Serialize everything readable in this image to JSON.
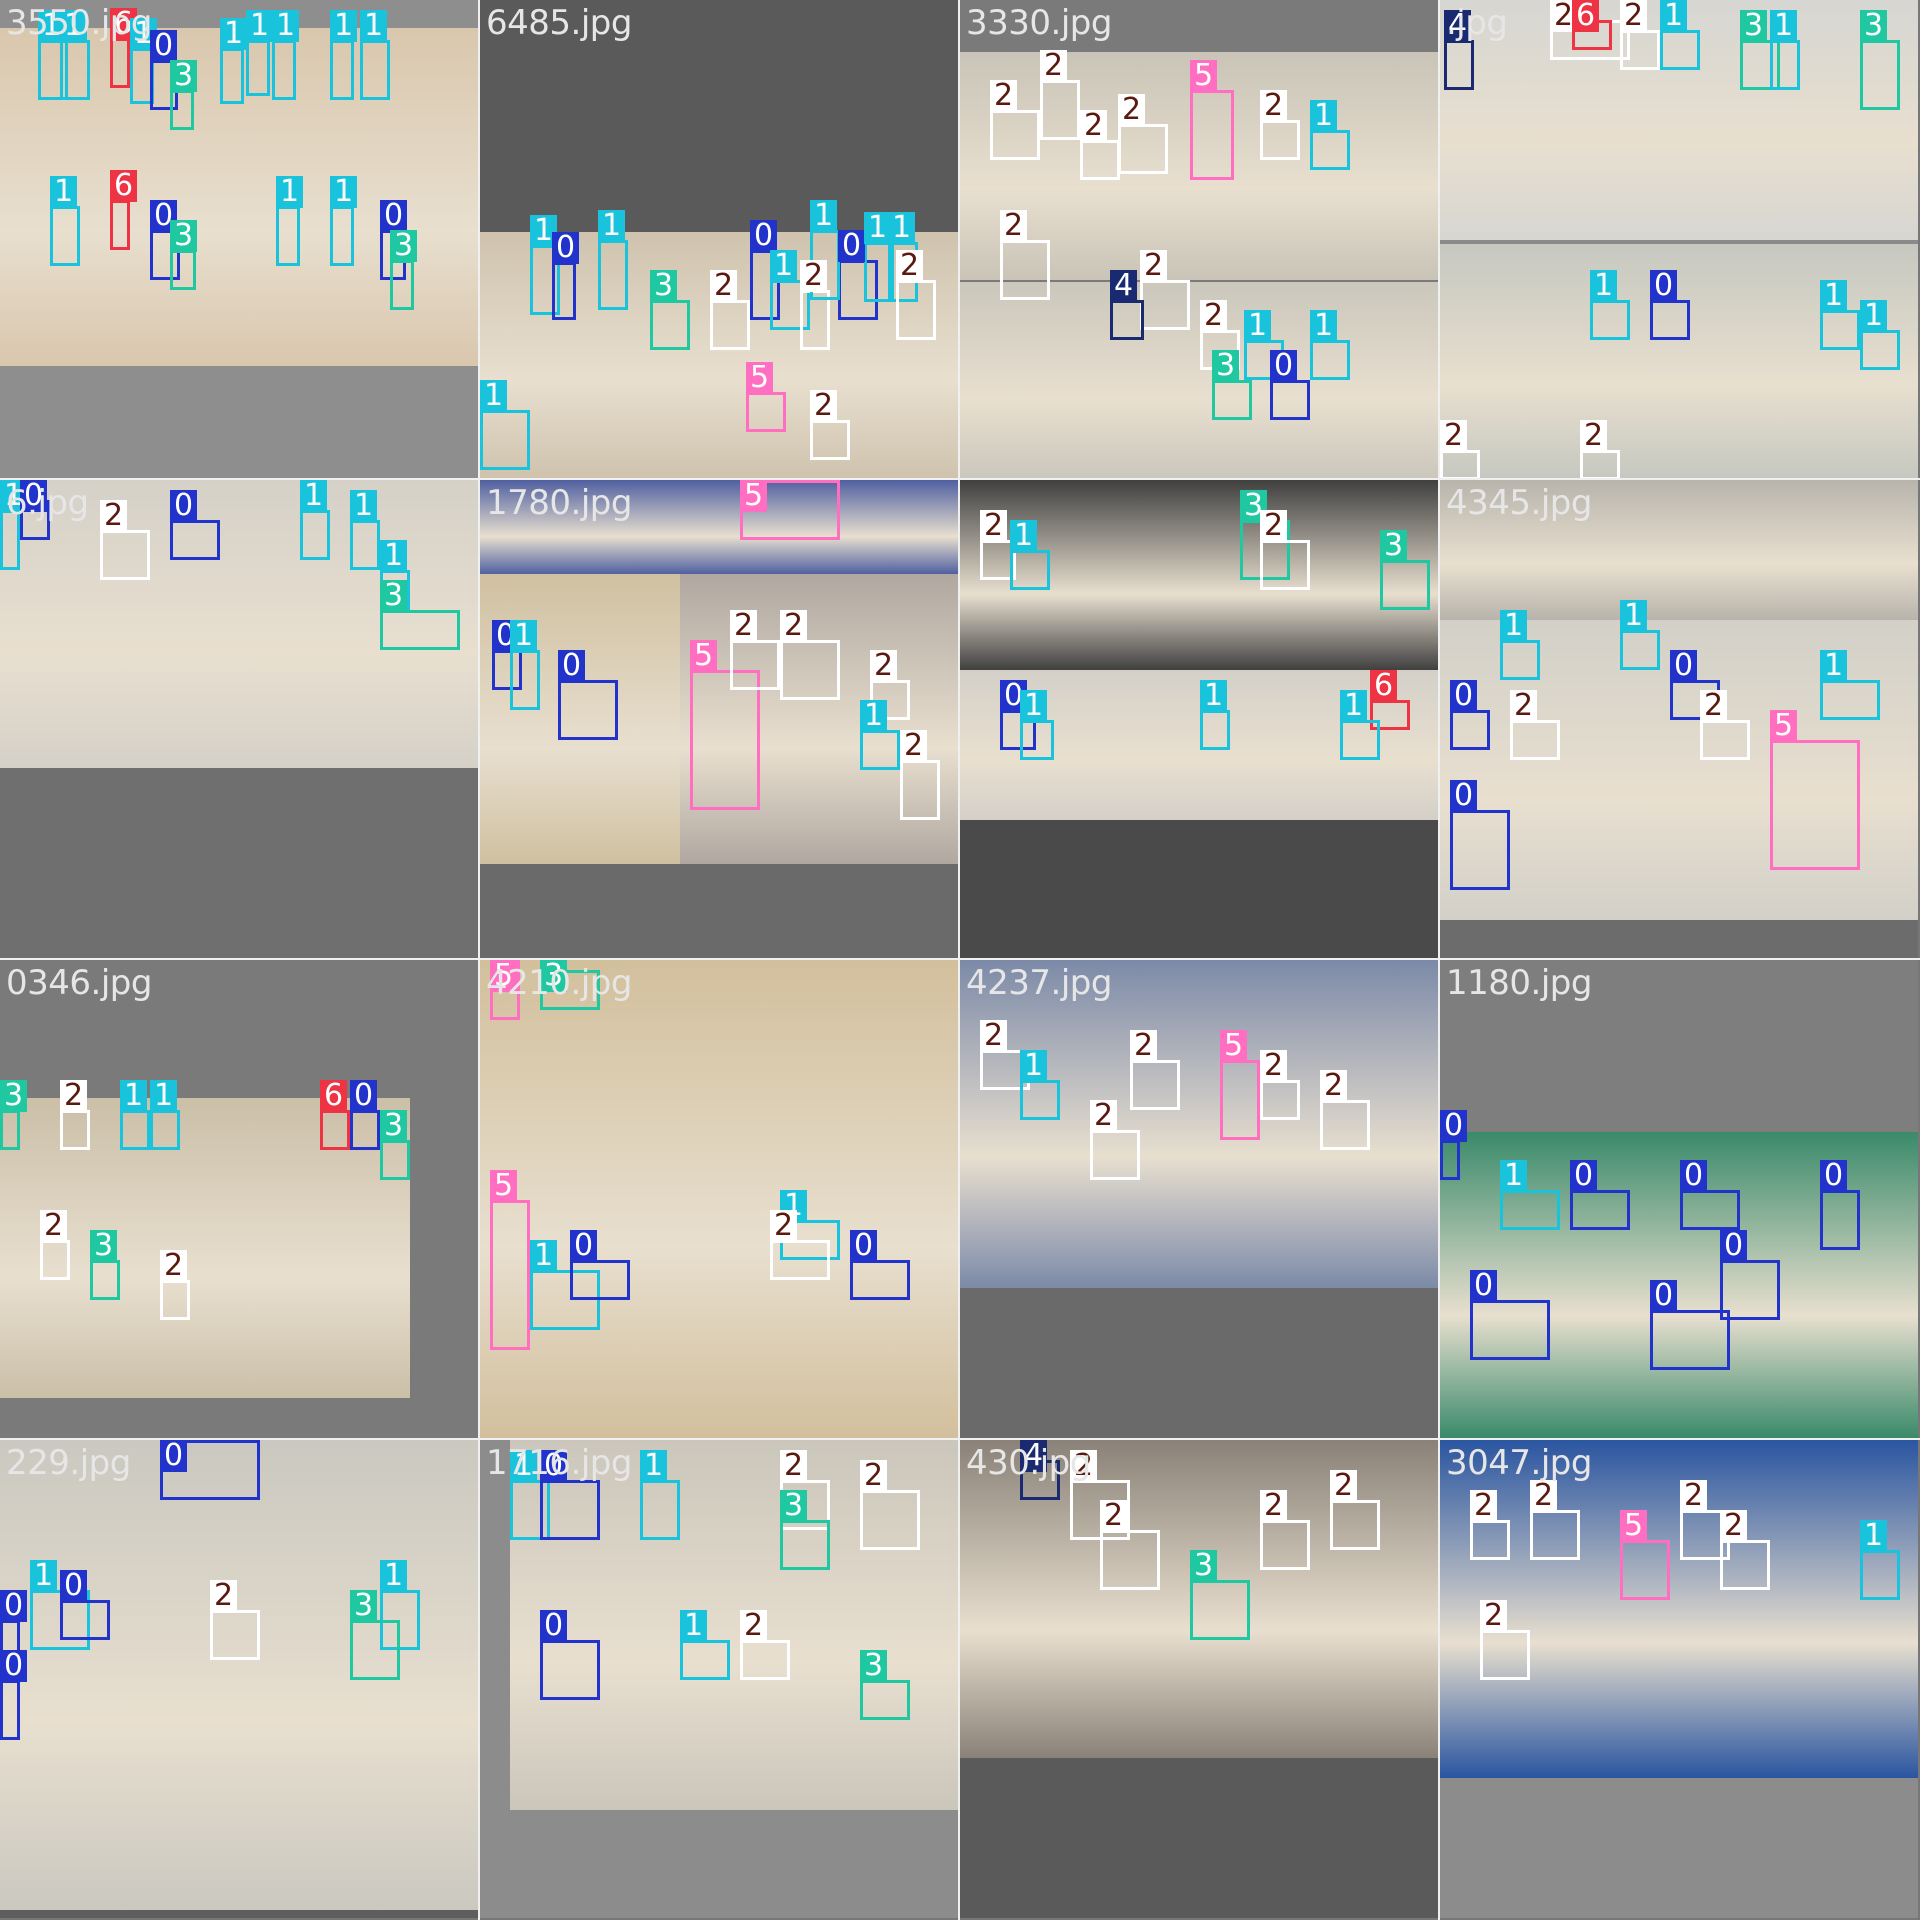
{
  "palette": {
    "0": {
      "border": "#2233cc",
      "bg": "#2233cc",
      "fg": "#ffffff"
    },
    "1": {
      "border": "#19c3dc",
      "bg": "#19c3dc",
      "fg": "#ffffff"
    },
    "2": {
      "border": "#ffffff",
      "bg": "#ffffff",
      "fg": "#5a1a10"
    },
    "3": {
      "border": "#1fc8a0",
      "bg": "#1fc8a0",
      "fg": "#ffffff"
    },
    "4": {
      "border": "#1a2a70",
      "bg": "#1a2a70",
      "fg": "#ffffff"
    },
    "5": {
      "border": "#ff6ec0",
      "bg": "#ff6ec0",
      "fg": "#ffffff"
    },
    "6": {
      "border": "#ee3344",
      "bg": "#ee3344",
      "fg": "#ffffff"
    }
  },
  "tiles": [
    {
      "name": "3550.jpg",
      "bg": "#8e8e8e"
    },
    {
      "name": "6485.jpg",
      "bg": "#5a5a5a"
    },
    {
      "name": "3330.jpg",
      "bg": "#7a7a7a"
    },
    {
      "name": ".jpg",
      "bg": "#8a8a8a"
    },
    {
      "name": "6.jpg",
      "bg": "#6f6f6f"
    },
    {
      "name": "1780.jpg",
      "bg": "#6a6a6a"
    },
    {
      "name": "",
      "bg": "#4a4a4a"
    },
    {
      "name": "4345.jpg",
      "bg": "#6c6c6c"
    },
    {
      "name": "0346.jpg",
      "bg": "#7a7a7a"
    },
    {
      "name": "4210.jpg",
      "bg": "#8a7a6a"
    },
    {
      "name": "4237.jpg",
      "bg": "#6a6a6a"
    },
    {
      "name": "1180.jpg",
      "bg": "#7e7e7e"
    },
    {
      "name": "229.jpg",
      "bg": "#5e5e5e"
    },
    {
      "name": "1716.jpg",
      "bg": "#8c8c8c"
    },
    {
      "name": "430.jpg",
      "bg": "#5a5a5a"
    },
    {
      "name": "3047.jpg",
      "bg": "#8c8c8c"
    }
  ],
  "detections": [
    {
      "tile": 0,
      "cls": "1"
    },
    {
      "tile": 0,
      "cls": "1"
    },
    {
      "tile": 0,
      "cls": "6"
    },
    {
      "tile": 0,
      "cls": "1"
    },
    {
      "tile": 0,
      "cls": "0"
    },
    {
      "tile": 0,
      "cls": "3"
    },
    {
      "tile": 0,
      "cls": "1"
    },
    {
      "tile": 0,
      "cls": "1"
    },
    {
      "tile": 0,
      "cls": "1"
    },
    {
      "tile": 0,
      "cls": "1"
    },
    {
      "tile": 0,
      "cls": "1"
    },
    {
      "tile": 0,
      "cls": "0"
    },
    {
      "tile": 0,
      "cls": "3"
    },
    {
      "tile": 0,
      "cls": "1"
    },
    {
      "tile": 0,
      "cls": "6"
    },
    {
      "tile": 0,
      "cls": "0"
    },
    {
      "tile": 0,
      "cls": "3"
    },
    {
      "tile": 0,
      "cls": "1"
    },
    {
      "tile": 0,
      "cls": "1"
    },
    {
      "tile": 1,
      "cls": "1"
    },
    {
      "tile": 1,
      "cls": "0"
    },
    {
      "tile": 1,
      "cls": "1"
    },
    {
      "tile": 1,
      "cls": "3"
    },
    {
      "tile": 1,
      "cls": "2"
    },
    {
      "tile": 1,
      "cls": "0"
    },
    {
      "tile": 1,
      "cls": "1"
    },
    {
      "tile": 1,
      "cls": "2"
    },
    {
      "tile": 1,
      "cls": "0"
    },
    {
      "tile": 1,
      "cls": "1"
    },
    {
      "tile": 1,
      "cls": "1"
    },
    {
      "tile": 1,
      "cls": "2"
    },
    {
      "tile": 1,
      "cls": "1"
    },
    {
      "tile": 1,
      "cls": "5"
    },
    {
      "tile": 1,
      "cls": "1"
    },
    {
      "tile": 1,
      "cls": "2"
    },
    {
      "tile": 2,
      "cls": "2"
    },
    {
      "tile": 2,
      "cls": "2"
    },
    {
      "tile": 2,
      "cls": "5"
    },
    {
      "tile": 2,
      "cls": "2"
    },
    {
      "tile": 2,
      "cls": "2"
    },
    {
      "tile": 2,
      "cls": "1"
    },
    {
      "tile": 2,
      "cls": "2"
    },
    {
      "tile": 2,
      "cls": "2"
    },
    {
      "tile": 2,
      "cls": "4"
    },
    {
      "tile": 2,
      "cls": "2"
    },
    {
      "tile": 2,
      "cls": "3"
    },
    {
      "tile": 2,
      "cls": "1"
    },
    {
      "tile": 2,
      "cls": "0"
    },
    {
      "tile": 2,
      "cls": "1"
    },
    {
      "tile": 2,
      "cls": "2"
    },
    {
      "tile": 3,
      "cls": "4"
    },
    {
      "tile": 3,
      "cls": "2"
    },
    {
      "tile": 3,
      "cls": "6"
    },
    {
      "tile": 3,
      "cls": "2"
    },
    {
      "tile": 3,
      "cls": "1"
    },
    {
      "tile": 3,
      "cls": "3"
    },
    {
      "tile": 3,
      "cls": "3"
    },
    {
      "tile": 3,
      "cls": "1"
    },
    {
      "tile": 3,
      "cls": "1"
    },
    {
      "tile": 3,
      "cls": "0"
    },
    {
      "tile": 3,
      "cls": "1"
    },
    {
      "tile": 3,
      "cls": "1"
    },
    {
      "tile": 3,
      "cls": "2"
    },
    {
      "tile": 3,
      "cls": "2"
    },
    {
      "tile": 4,
      "cls": "1"
    },
    {
      "tile": 4,
      "cls": "0"
    },
    {
      "tile": 4,
      "cls": "2"
    },
    {
      "tile": 4,
      "cls": "0"
    },
    {
      "tile": 4,
      "cls": "1"
    },
    {
      "tile": 4,
      "cls": "1"
    },
    {
      "tile": 4,
      "cls": "1"
    },
    {
      "tile": 4,
      "cls": "3"
    },
    {
      "tile": 5,
      "cls": "5"
    },
    {
      "tile": 5,
      "cls": "0"
    },
    {
      "tile": 5,
      "cls": "1"
    },
    {
      "tile": 5,
      "cls": "0"
    },
    {
      "tile": 5,
      "cls": "5"
    },
    {
      "tile": 5,
      "cls": "2"
    },
    {
      "tile": 5,
      "cls": "2"
    },
    {
      "tile": 5,
      "cls": "2"
    },
    {
      "tile": 5,
      "cls": "1"
    },
    {
      "tile": 5,
      "cls": "2"
    },
    {
      "tile": 6,
      "cls": "2"
    },
    {
      "tile": 6,
      "cls": "1"
    },
    {
      "tile": 6,
      "cls": "3"
    },
    {
      "tile": 6,
      "cls": "2"
    },
    {
      "tile": 6,
      "cls": "3"
    },
    {
      "tile": 6,
      "cls": "0"
    },
    {
      "tile": 6,
      "cls": "1"
    },
    {
      "tile": 6,
      "cls": "1"
    },
    {
      "tile": 6,
      "cls": "6"
    },
    {
      "tile": 6,
      "cls": "1"
    },
    {
      "tile": 7,
      "cls": "1"
    },
    {
      "tile": 7,
      "cls": "0"
    },
    {
      "tile": 7,
      "cls": "2"
    },
    {
      "tile": 7,
      "cls": "1"
    },
    {
      "tile": 7,
      "cls": "0"
    },
    {
      "tile": 7,
      "cls": "5"
    },
    {
      "tile": 7,
      "cls": "0"
    },
    {
      "tile": 7,
      "cls": "2"
    },
    {
      "tile": 7,
      "cls": "1"
    },
    {
      "tile": 8,
      "cls": "3"
    },
    {
      "tile": 8,
      "cls": "2"
    },
    {
      "tile": 8,
      "cls": "1"
    },
    {
      "tile": 8,
      "cls": "1"
    },
    {
      "tile": 8,
      "cls": "6"
    },
    {
      "tile": 8,
      "cls": "0"
    },
    {
      "tile": 8,
      "cls": "3"
    },
    {
      "tile": 8,
      "cls": "2"
    },
    {
      "tile": 8,
      "cls": "3"
    },
    {
      "tile": 8,
      "cls": "2"
    },
    {
      "tile": 9,
      "cls": "5"
    },
    {
      "tile": 9,
      "cls": "3"
    },
    {
      "tile": 9,
      "cls": "5"
    },
    {
      "tile": 9,
      "cls": "1"
    },
    {
      "tile": 9,
      "cls": "0"
    },
    {
      "tile": 9,
      "cls": "1"
    },
    {
      "tile": 9,
      "cls": "2"
    },
    {
      "tile": 9,
      "cls": "0"
    },
    {
      "tile": 10,
      "cls": "2"
    },
    {
      "tile": 10,
      "cls": "1"
    },
    {
      "tile": 10,
      "cls": "2"
    },
    {
      "tile": 10,
      "cls": "5"
    },
    {
      "tile": 10,
      "cls": "2"
    },
    {
      "tile": 10,
      "cls": "2"
    },
    {
      "tile": 10,
      "cls": "2"
    },
    {
      "tile": 11,
      "cls": "0"
    },
    {
      "tile": 11,
      "cls": "1"
    },
    {
      "tile": 11,
      "cls": "0"
    },
    {
      "tile": 11,
      "cls": "0"
    },
    {
      "tile": 11,
      "cls": "0"
    },
    {
      "tile": 11,
      "cls": "0"
    },
    {
      "tile": 11,
      "cls": "0"
    },
    {
      "tile": 11,
      "cls": "0"
    },
    {
      "tile": 12,
      "cls": "0"
    },
    {
      "tile": 12,
      "cls": "0"
    },
    {
      "tile": 12,
      "cls": "1"
    },
    {
      "tile": 12,
      "cls": "0"
    },
    {
      "tile": 12,
      "cls": "2"
    },
    {
      "tile": 12,
      "cls": "1"
    },
    {
      "tile": 12,
      "cls": "3"
    },
    {
      "tile": 12,
      "cls": "0"
    },
    {
      "tile": 13,
      "cls": "1"
    },
    {
      "tile": 13,
      "cls": "0"
    },
    {
      "tile": 13,
      "cls": "1"
    },
    {
      "tile": 13,
      "cls": "2"
    },
    {
      "tile": 13,
      "cls": "3"
    },
    {
      "tile": 13,
      "cls": "2"
    },
    {
      "tile": 13,
      "cls": "0"
    },
    {
      "tile": 13,
      "cls": "1"
    },
    {
      "tile": 13,
      "cls": "2"
    },
    {
      "tile": 13,
      "cls": "3"
    },
    {
      "tile": 14,
      "cls": "4"
    },
    {
      "tile": 14,
      "cls": "2"
    },
    {
      "tile": 14,
      "cls": "2"
    },
    {
      "tile": 14,
      "cls": "3"
    },
    {
      "tile": 14,
      "cls": "2"
    },
    {
      "tile": 14,
      "cls": "2"
    },
    {
      "tile": 15,
      "cls": "2"
    },
    {
      "tile": 15,
      "cls": "2"
    },
    {
      "tile": 15,
      "cls": "5"
    },
    {
      "tile": 15,
      "cls": "2"
    },
    {
      "tile": 15,
      "cls": "2"
    },
    {
      "tile": 15,
      "cls": "1"
    },
    {
      "tile": 15,
      "cls": "2"
    }
  ]
}
